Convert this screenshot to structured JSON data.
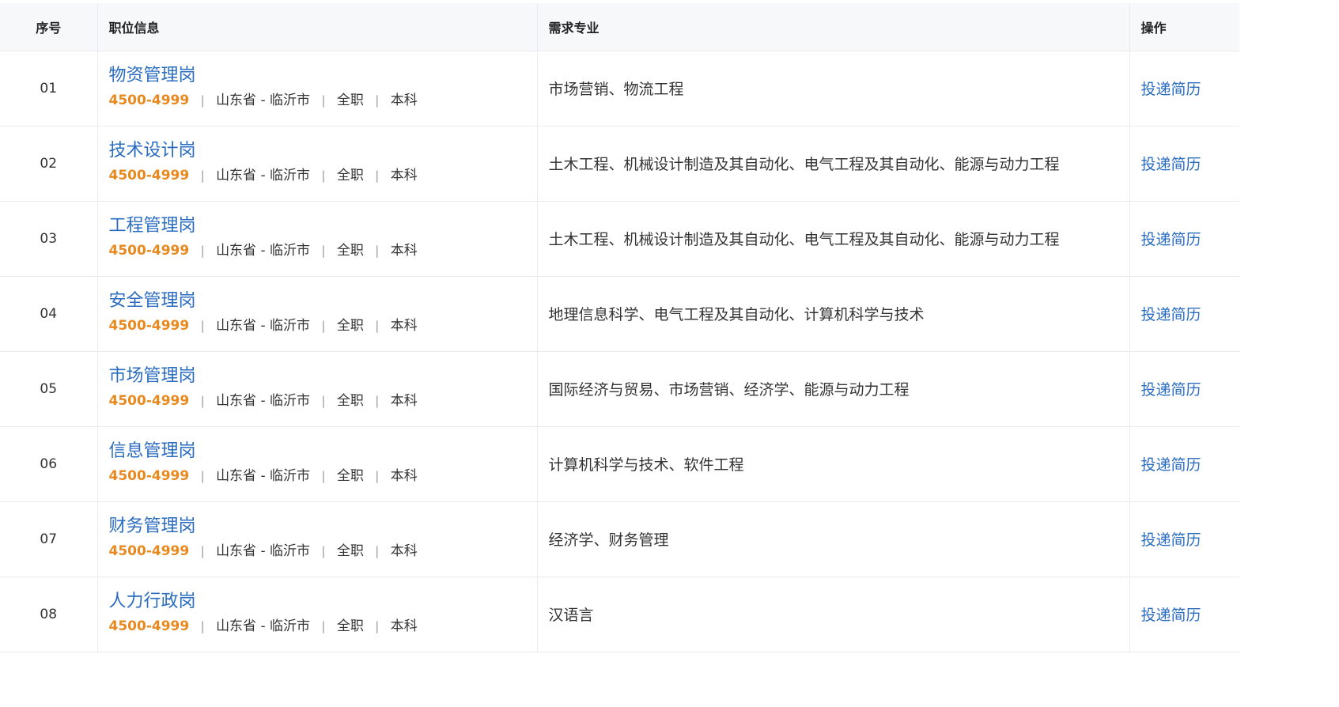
{
  "table": {
    "headers": {
      "index": "序号",
      "position": "职位信息",
      "major": "需求专业",
      "action": "操作"
    },
    "separator": "|",
    "rows": [
      {
        "index": "01",
        "title": "物资管理岗",
        "salary": "4500-4999",
        "location": "山东省 - 临沂市",
        "type": "全职",
        "education": "本科",
        "major": "市场营销、物流工程",
        "action": "投递简历"
      },
      {
        "index": "02",
        "title": "技术设计岗",
        "salary": "4500-4999",
        "location": "山东省 - 临沂市",
        "type": "全职",
        "education": "本科",
        "major": "土木工程、机械设计制造及其自动化、电气工程及其自动化、能源与动力工程",
        "action": "投递简历"
      },
      {
        "index": "03",
        "title": "工程管理岗",
        "salary": "4500-4999",
        "location": "山东省 - 临沂市",
        "type": "全职",
        "education": "本科",
        "major": "土木工程、机械设计制造及其自动化、电气工程及其自动化、能源与动力工程",
        "action": "投递简历"
      },
      {
        "index": "04",
        "title": "安全管理岗",
        "salary": "4500-4999",
        "location": "山东省 - 临沂市",
        "type": "全职",
        "education": "本科",
        "major": "地理信息科学、电气工程及其自动化、计算机科学与技术",
        "action": "投递简历"
      },
      {
        "index": "05",
        "title": "市场管理岗",
        "salary": "4500-4999",
        "location": "山东省 - 临沂市",
        "type": "全职",
        "education": "本科",
        "major": "国际经济与贸易、市场营销、经济学、能源与动力工程",
        "action": "投递简历"
      },
      {
        "index": "06",
        "title": "信息管理岗",
        "salary": "4500-4999",
        "location": "山东省 - 临沂市",
        "type": "全职",
        "education": "本科",
        "major": "计算机科学与技术、软件工程",
        "action": "投递简历"
      },
      {
        "index": "07",
        "title": "财务管理岗",
        "salary": "4500-4999",
        "location": "山东省 - 临沂市",
        "type": "全职",
        "education": "本科",
        "major": "经济学、财务管理",
        "action": "投递简历"
      },
      {
        "index": "08",
        "title": "人力行政岗",
        "salary": "4500-4999",
        "location": "山东省 - 临沂市",
        "type": "全职",
        "education": "本科",
        "major": "汉语言",
        "action": "投递简历"
      }
    ]
  },
  "colors": {
    "link": "#2a6cc0",
    "salary": "#e8891f",
    "header_bg": "#f7f8fa",
    "border": "#e8eaee"
  }
}
